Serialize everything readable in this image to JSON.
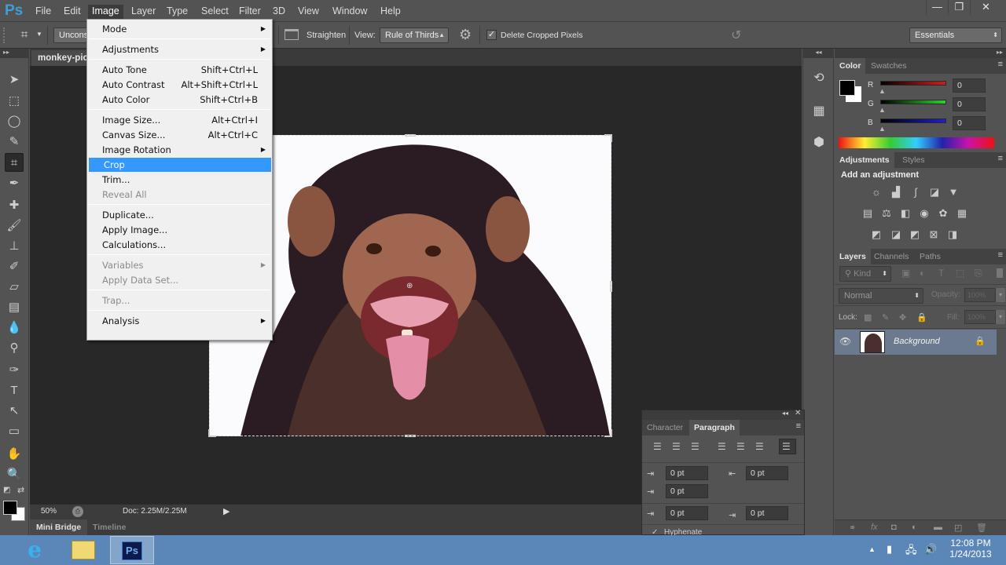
{
  "app": {
    "logo": "Ps"
  },
  "menubar": {
    "items": [
      "File",
      "Edit",
      "Image",
      "Layer",
      "Type",
      "Select",
      "Filter",
      "3D",
      "View",
      "Window",
      "Help"
    ],
    "active": "Image"
  },
  "window_controls": {
    "minimize": "—",
    "restore": "❐",
    "close": "✕"
  },
  "options_bar": {
    "ratio_preset": "Uncons",
    "straighten_label": "Straighten",
    "view_label": "View:",
    "view_value": "Rule of Thirds",
    "delete_cropped_label": "Delete Cropped Pixels",
    "delete_cropped_checked": true,
    "workspace": "Essentials"
  },
  "document": {
    "tab_title": "monkey-pic",
    "zoom": "50%",
    "doc_info": "Doc: 2.25M/2.25M",
    "bottom_tabs": [
      "Mini Bridge",
      "Timeline"
    ]
  },
  "image_menu": {
    "items": [
      {
        "label": "Mode",
        "shortcut": "",
        "submenu": true,
        "disabled": false
      },
      {
        "sep": true
      },
      {
        "label": "Adjustments",
        "shortcut": "",
        "submenu": true,
        "disabled": false
      },
      {
        "sep": true
      },
      {
        "label": "Auto Tone",
        "shortcut": "Shift+Ctrl+L",
        "submenu": false,
        "disabled": false
      },
      {
        "label": "Auto Contrast",
        "shortcut": "Alt+Shift+Ctrl+L",
        "submenu": false,
        "disabled": false
      },
      {
        "label": "Auto Color",
        "shortcut": "Shift+Ctrl+B",
        "submenu": false,
        "disabled": false
      },
      {
        "sep": true
      },
      {
        "label": "Image Size...",
        "shortcut": "Alt+Ctrl+I",
        "submenu": false,
        "disabled": false
      },
      {
        "label": "Canvas Size...",
        "shortcut": "Alt+Ctrl+C",
        "submenu": false,
        "disabled": false
      },
      {
        "label": "Image Rotation",
        "shortcut": "",
        "submenu": true,
        "disabled": false
      },
      {
        "label": "Crop",
        "shortcut": "",
        "submenu": false,
        "disabled": false,
        "highlighted": true
      },
      {
        "label": "Trim...",
        "shortcut": "",
        "submenu": false,
        "disabled": false
      },
      {
        "label": "Reveal All",
        "shortcut": "",
        "submenu": false,
        "disabled": true
      },
      {
        "sep": true
      },
      {
        "label": "Duplicate...",
        "shortcut": "",
        "submenu": false,
        "disabled": false
      },
      {
        "label": "Apply Image...",
        "shortcut": "",
        "submenu": false,
        "disabled": false
      },
      {
        "label": "Calculations...",
        "shortcut": "",
        "submenu": false,
        "disabled": false
      },
      {
        "sep": true
      },
      {
        "label": "Variables",
        "shortcut": "",
        "submenu": true,
        "disabled": true
      },
      {
        "label": "Apply Data Set...",
        "shortcut": "",
        "submenu": false,
        "disabled": true
      },
      {
        "sep": true
      },
      {
        "label": "Trap...",
        "shortcut": "",
        "submenu": false,
        "disabled": true
      },
      {
        "sep": true
      },
      {
        "label": "Analysis",
        "shortcut": "",
        "submenu": true,
        "disabled": false
      }
    ]
  },
  "color_panel": {
    "tabs": [
      "Color",
      "Swatches"
    ],
    "channels": [
      {
        "label": "R",
        "value": "0",
        "color": "#cc1f1f"
      },
      {
        "label": "G",
        "value": "0",
        "color": "#2fd12f"
      },
      {
        "label": "B",
        "value": "0",
        "color": "#1f1fcc"
      }
    ],
    "foreground": "#000000",
    "background": "#ffffff"
  },
  "adjustments_panel": {
    "tabs": [
      "Adjustments",
      "Styles"
    ],
    "heading": "Add an adjustment"
  },
  "layers_panel": {
    "tabs": [
      "Layers",
      "Channels",
      "Paths"
    ],
    "filter_kind": "Kind",
    "blend_mode": "Normal",
    "opacity_label": "Opacity:",
    "opacity_value": "100%",
    "lock_label": "Lock:",
    "fill_label": "Fill:",
    "fill_value": "100%",
    "layers": [
      {
        "name": "Background",
        "visible": true,
        "locked": true
      }
    ]
  },
  "paragraph_panel": {
    "tabs": [
      "Character",
      "Paragraph"
    ],
    "indent_left": "0 pt",
    "indent_right": "0 pt",
    "indent_first": "0 pt",
    "space_before": "0 pt",
    "space_after": "0 pt",
    "hyphenate_label": "Hyphenate",
    "hyphenate_checked": true
  },
  "taskbar": {
    "time": "12:08 PM",
    "date": "1/24/2013",
    "ps_label": "Ps"
  }
}
